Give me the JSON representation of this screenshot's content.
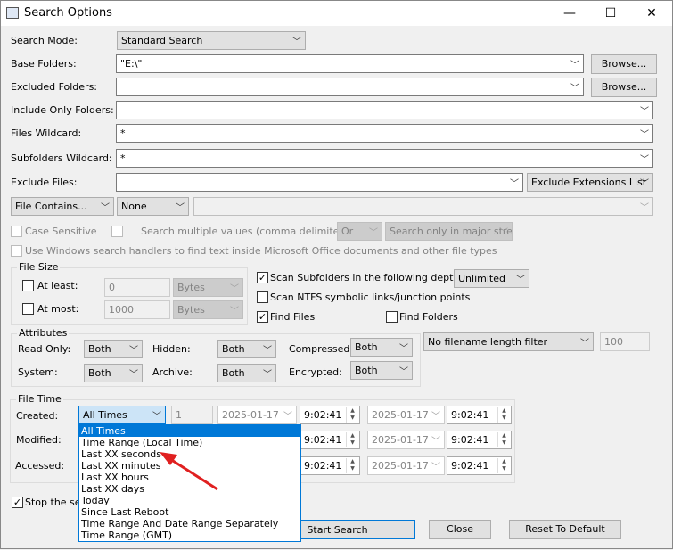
{
  "window": {
    "title": "Search Options",
    "minimize": "—",
    "maximize": "☐",
    "close": "✕"
  },
  "labels": {
    "search_mode": "Search Mode:",
    "base_folders": "Base Folders:",
    "excluded_folders": "Excluded Folders:",
    "include_only": "Include Only Folders:",
    "files_wildcard": "Files Wildcard:",
    "subfolders_wildcard": "Subfolders Wildcard:",
    "exclude_files": "Exclude Files:"
  },
  "fields": {
    "search_mode": "Standard Search",
    "base_folders": "\"E:\\\"",
    "excluded_folders": "",
    "include_only": "",
    "files_wildcard": "*",
    "subfolders_wildcard": "*",
    "exclude_files": "",
    "exclude_ext": "Exclude Extensions List",
    "browse": "Browse..."
  },
  "contains": {
    "mode": "File Contains...",
    "type": "None",
    "value": "",
    "case_sensitive": "Case Sensitive",
    "multiple": "Search multiple values (comma delimited)",
    "or": "Or",
    "streams": "Search only in major stre:",
    "windows_handlers": "Use Windows search handlers to find text inside Microsoft Office documents and other file types"
  },
  "file_size": {
    "title": "File Size",
    "at_least": "At least:",
    "at_least_value": "0",
    "at_least_unit": "Bytes",
    "at_most": "At most:",
    "at_most_value": "1000",
    "at_most_unit": "Bytes"
  },
  "options": {
    "scan_subfolders": "Scan Subfolders in the following depth:",
    "scan_subfolders_checked": true,
    "depth": "Unlimited",
    "scan_ntfs": "Scan NTFS symbolic links/junction points",
    "find_files": "Find Files",
    "find_files_checked": true,
    "find_folders": "Find Folders",
    "filename_length": "No filename length filter",
    "filename_length_value": "100"
  },
  "attributes": {
    "title": "Attributes",
    "read_only": "Read Only:",
    "hidden": "Hidden:",
    "compressed": "Compressed:",
    "system": "System:",
    "archive": "Archive:",
    "encrypted": "Encrypted:",
    "value": "Both"
  },
  "file_time": {
    "title": "File Time",
    "created": "Created:",
    "modified": "Modified:",
    "accessed": "Accessed:",
    "created_mode": "All Times",
    "count": "1",
    "date": "2025-01-17",
    "time": "9:02:41"
  },
  "dropdown": {
    "items": [
      "All Times",
      "Time Range (Local Time)",
      "Last XX seconds",
      "Last XX minutes",
      "Last XX hours",
      "Last XX days",
      "Today",
      "Since Last Reboot",
      "Time Range And Date Range Separately",
      "Time Range (GMT)"
    ],
    "selected": "All Times"
  },
  "footer": {
    "stop": "Stop the sea",
    "start": "Start Search",
    "close": "Close",
    "reset": "Reset To Default"
  },
  "colors": {
    "accent": "#0078d7",
    "arrow": "#e02020"
  }
}
